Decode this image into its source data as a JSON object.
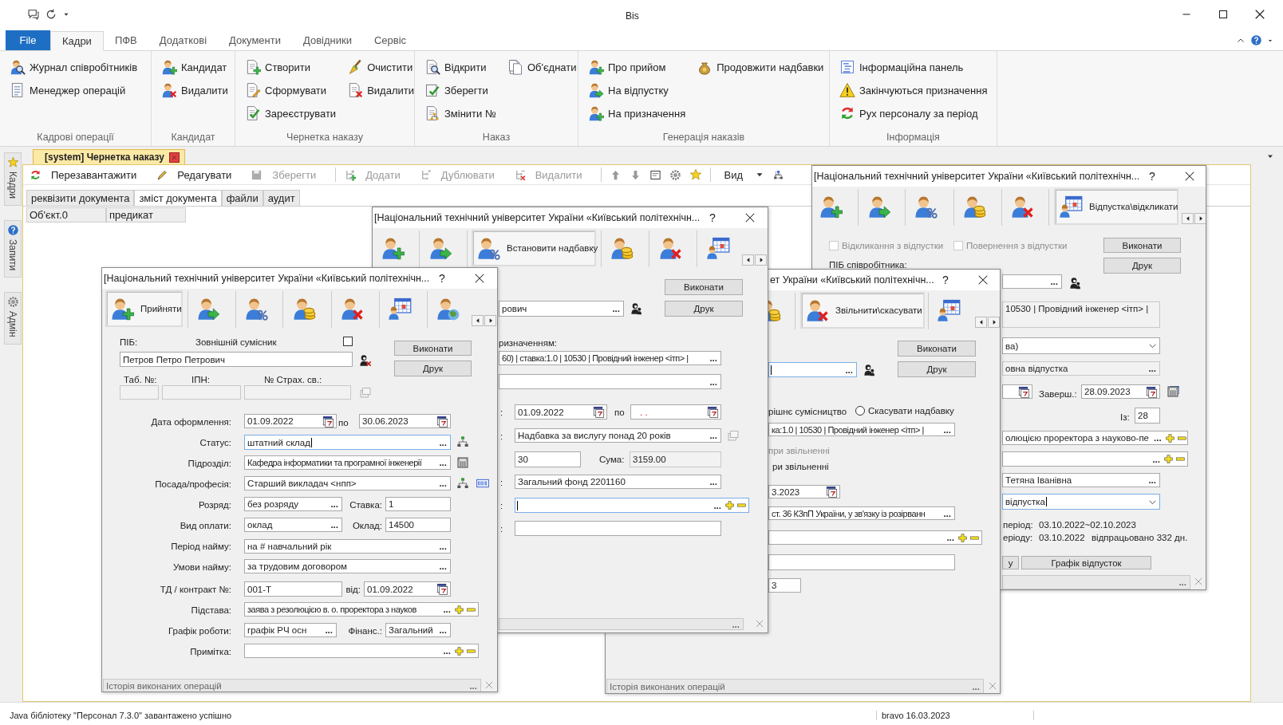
{
  "window": {
    "title": "Bis"
  },
  "ribbon": {
    "file_button": "File",
    "tabs": [
      {
        "label": "Кадри",
        "selected": true
      },
      {
        "label": "ПФВ",
        "selected": false
      },
      {
        "label": "Додаткові",
        "selected": false
      },
      {
        "label": "Документи",
        "selected": false
      },
      {
        "label": "Довідники",
        "selected": false
      },
      {
        "label": "Сервіс",
        "selected": false
      }
    ],
    "groups": [
      {
        "label": "Кадрові операції",
        "columns": [
          [
            {
              "label": "Журнал співробітників"
            },
            {
              "label": "Менеджер операцій"
            }
          ]
        ]
      },
      {
        "label": "Кандидат",
        "columns": [
          [
            {
              "label": "Кандидат"
            },
            {
              "label": "Видалити"
            }
          ]
        ]
      },
      {
        "label": "Чернетка наказу",
        "columns": [
          [
            {
              "label": "Створити"
            },
            {
              "label": "Сформувати"
            },
            {
              "label": "Зареєструвати"
            }
          ],
          [
            {
              "label": "Очистити"
            },
            {
              "label": "Видалити"
            }
          ]
        ]
      },
      {
        "label": "Наказ",
        "columns": [
          [
            {
              "label": "Відкрити"
            },
            {
              "label": "Зберегти"
            },
            {
              "label": "Змінити №"
            }
          ],
          [
            {
              "label": "Об'єднати"
            }
          ]
        ]
      },
      {
        "label": "Генерація наказів",
        "columns": [
          [
            {
              "label": "Про прийом"
            },
            {
              "label": "На відпустку"
            },
            {
              "label": "На призначення"
            }
          ],
          [
            {
              "label": "Продовжити надбавки"
            }
          ]
        ]
      },
      {
        "label": "Інформація",
        "columns": [
          [
            {
              "label": "Інформаційна панель"
            },
            {
              "label": "Закінчуються призначення"
            },
            {
              "label": "Рух персоналу за період"
            }
          ]
        ]
      }
    ]
  },
  "sidebar": [
    {
      "label": "Кадри"
    },
    {
      "label": "Запити"
    },
    {
      "label": "Адмін"
    }
  ],
  "document_tab": {
    "label": "[system] Чернетка наказу"
  },
  "toolbar": {
    "items": [
      {
        "label": "Перезавантажити",
        "disabled": false
      },
      {
        "label": "Редагувати",
        "disabled": false
      },
      {
        "label": "Зберегти",
        "disabled": true
      },
      {
        "label": "Додати",
        "disabled": true
      },
      {
        "label": "Дублювати",
        "disabled": true
      },
      {
        "label": "Видалити",
        "disabled": true
      }
    ],
    "view": "Вид"
  },
  "document_tabs": [
    {
      "label": "реквізити документа",
      "selected": false
    },
    {
      "label": "зміст документа",
      "selected": true
    },
    {
      "label": "файли",
      "selected": false
    },
    {
      "label": "аудит",
      "selected": false
    }
  ],
  "grid_columns": [
    "Об'єкт.0",
    "предикат"
  ],
  "dialogs": [
    {
      "title": "[Національний технічний університет України «Київський політехнічн...",
      "help": "?",
      "tools": [
        {
          "selected": false
        },
        {
          "selected": false
        },
        {
          "selected": false
        },
        {
          "selected": false
        },
        {
          "selected": false
        },
        {
          "label": "Відпустка\\відкликати",
          "selected": true
        }
      ],
      "controls": [
        {
          "kind": "checkbox",
          "label": "Відкликання з відпустки",
          "checked": false,
          "disabled": true
        },
        {
          "kind": "checkbox",
          "label": "Повернення з відпустки",
          "checked": false,
          "disabled": true
        },
        {
          "kind": "button",
          "label": "Виконати"
        },
        {
          "kind": "button",
          "label": "Друк"
        },
        {
          "kind": "label",
          "text": "ПІБ співробітника:"
        },
        {
          "kind": "field",
          "ellipsis": "...",
          "focused": false,
          "readonly": false
        },
        {
          "kind": "field",
          "value": "10530 | Провідний інженер <ітп> |",
          "focused": false,
          "readonly": true
        },
        {
          "kind": "dropdown",
          "value": "ва)",
          "focused": false,
          "readonly": false
        },
        {
          "kind": "field",
          "value": "овна відпустка",
          "ellipsis": "...",
          "focused": false,
          "readonly": true
        },
        {
          "kind": "date",
          "focused": false,
          "readonly": false
        },
        {
          "kind": "label",
          "text": "Заверш.:"
        },
        {
          "kind": "date",
          "value": "28.09.2023",
          "focused": false,
          "readonly": false
        },
        {
          "kind": "label",
          "text": "Із:"
        },
        {
          "kind": "field",
          "value": "28",
          "focused": false,
          "readonly": false
        },
        {
          "kind": "field",
          "value": "олюцією проректора з науково-пе",
          "ellipsis": "...",
          "plus_minus": true,
          "focused": false,
          "readonly": false
        },
        {
          "kind": "field",
          "ellipsis": "...",
          "plus_minus": true,
          "focused": false,
          "readonly": false
        },
        {
          "kind": "field",
          "value": "Тетяна Іванівна",
          "ellipsis": "...",
          "focused": false,
          "readonly": false
        },
        {
          "kind": "dropdown",
          "value": "відпустка",
          "focused": true,
          "readonly": false
        },
        {
          "kind": "label",
          "text": "період:"
        },
        {
          "kind": "label",
          "text": "03.10.2022~02.10.2023"
        },
        {
          "kind": "label",
          "text": "еріоду:"
        },
        {
          "kind": "label",
          "text": "03.10.2022"
        },
        {
          "kind": "label",
          "text": "відпрацьовано 332 дн."
        },
        {
          "kind": "button",
          "label": "у"
        },
        {
          "kind": "button",
          "label": "Графік відпусток"
        },
        {
          "kind": "status",
          "ellipsis": "...",
          "focused": false,
          "readonly": true
        }
      ]
    },
    {
      "title": "ет України «Київський політехнічн...",
      "help": "?",
      "tools": [
        {
          "selected": false
        },
        {
          "label": "Звільнити\\скасувати",
          "selected": true
        },
        {
          "selected": false
        }
      ],
      "controls": [
        {
          "kind": "field",
          "ellipsis": "...",
          "focused": true,
          "readonly": false
        },
        {
          "kind": "button",
          "label": "Виконати"
        },
        {
          "kind": "button",
          "label": "Друк"
        },
        {
          "kind": "label",
          "text": "рішнє сумісництво"
        },
        {
          "kind": "radio",
          "label": "Скасувати надбавку",
          "selected": false
        },
        {
          "kind": "field",
          "value": "ка:1.0 | 10530 | Провідний інженер <ітп> |",
          "ellipsis": "...",
          "focused": false,
          "readonly": false
        },
        {
          "kind": "greyed",
          "text": "при звільненні"
        },
        {
          "kind": "label",
          "text": "ри звільненні"
        },
        {
          "kind": "date",
          "value": "3.2023",
          "focused": false,
          "readonly": false
        },
        {
          "kind": "field",
          "value": "ст. 36 КЗпП України, у зв'язку із розірванн",
          "ellipsis": "...",
          "focused": false,
          "readonly": false
        },
        {
          "kind": "field",
          "ellipsis": "...",
          "plus_minus": true,
          "focused": false,
          "readonly": false
        },
        {
          "kind": "field",
          "focused": false,
          "readonly": false
        },
        {
          "kind": "field",
          "value": "3",
          "focused": false,
          "readonly": false
        },
        {
          "kind": "status",
          "value": "Історія виконаних операцій",
          "ellipsis": "...",
          "focused": false,
          "readonly": true
        }
      ]
    },
    {
      "title": "[Національний технічний університет України «Київський політехнічн...",
      "help": "?",
      "tools": [
        {
          "selected": false
        },
        {
          "selected": false
        },
        {
          "label": "Встановити надбавку",
          "selected": true
        },
        {
          "selected": false
        },
        {
          "selected": false
        },
        {
          "selected": false
        }
      ],
      "controls": [
        {
          "kind": "field",
          "value": "рович",
          "ellipsis": "...",
          "focused": false,
          "readonly": false
        },
        {
          "kind": "button",
          "label": "Виконати"
        },
        {
          "kind": "button",
          "label": "Друк"
        },
        {
          "kind": "label",
          "text": "ризначенням:"
        },
        {
          "kind": "field",
          "value": "60) | ставка:1.0 | 10530 | Провідний інженер <ітп> |",
          "ellipsis": "...",
          "focused": false,
          "readonly": false
        },
        {
          "kind": "field",
          "ellipsis": "...",
          "focused": false,
          "readonly": false
        },
        {
          "kind": "label",
          "text": ":"
        },
        {
          "kind": "date",
          "value": "01.09.2022",
          "focused": false,
          "readonly": false
        },
        {
          "kind": "label",
          "text": "по"
        },
        {
          "kind": "date",
          "mask": ". .",
          "focused": false,
          "readonly": false
        },
        {
          "kind": "label",
          "text": ":"
        },
        {
          "kind": "field",
          "value": "Надбавка за вислугу понад 20 років",
          "ellipsis": "...",
          "focused": false,
          "readonly": false
        },
        {
          "kind": "field",
          "value": "30",
          "focused": false,
          "readonly": false
        },
        {
          "kind": "label",
          "text": "Сума:"
        },
        {
          "kind": "field",
          "value": "3159.00",
          "focused": false,
          "readonly": true
        },
        {
          "kind": "label",
          "text": ":"
        },
        {
          "kind": "field",
          "value": "Загальний фонд 2201160",
          "ellipsis": "...",
          "focused": false,
          "readonly": false
        },
        {
          "kind": "label",
          "text": ":"
        },
        {
          "kind": "field",
          "ellipsis": "...",
          "plus_minus": true,
          "focused": true,
          "readonly": false
        },
        {
          "kind": "label",
          "text": ":"
        },
        {
          "kind": "field",
          "focused": false,
          "readonly": false
        },
        {
          "kind": "status",
          "ellipsis": "...",
          "focused": false,
          "readonly": true
        }
      ]
    },
    {
      "title": "[Національний технічний університет України «Київський політехнічн...",
      "help": "?",
      "tools": [
        {
          "label": "Прийняти",
          "selected": true
        },
        {
          "selected": false
        },
        {
          "selected": false
        },
        {
          "selected": false
        },
        {
          "selected": false
        },
        {
          "selected": false
        },
        {
          "selected": false
        }
      ],
      "controls": [
        {
          "kind": "label",
          "text": "ПІБ:"
        },
        {
          "kind": "label",
          "text": "Зовнішній сумісник"
        },
        {
          "kind": "checkbox",
          "checked": false,
          "disabled": false
        },
        {
          "kind": "field",
          "value": "Петров Петро Петрович",
          "focused": false,
          "readonly": false
        },
        {
          "kind": "button",
          "label": "Виконати"
        },
        {
          "kind": "button",
          "label": "Друк"
        },
        {
          "kind": "label",
          "text": "Таб. №:"
        },
        {
          "kind": "label",
          "text": "ІПН:"
        },
        {
          "kind": "label",
          "text": "№ Страх. св.:"
        },
        {
          "kind": "field",
          "focused": false,
          "readonly": true
        },
        {
          "kind": "field",
          "focused": false,
          "readonly": true
        },
        {
          "kind": "field",
          "focused": false,
          "readonly": true
        },
        {
          "kind": "label",
          "text": "Дата оформлення:"
        },
        {
          "kind": "date",
          "value": "01.09.2022",
          "focused": false,
          "readonly": false
        },
        {
          "kind": "label",
          "text": "по"
        },
        {
          "kind": "date",
          "value": "30.06.2023",
          "focused": false,
          "readonly": false
        },
        {
          "kind": "label",
          "text": "Статус:"
        },
        {
          "kind": "field",
          "value": "штатний склад",
          "ellipsis": "...",
          "focused": true,
          "readonly": false
        },
        {
          "kind": "label",
          "text": "Підрозділ:"
        },
        {
          "kind": "field",
          "value": "Кафедра інформатики та програмної інженерії",
          "ellipsis": "...",
          "focused": false,
          "readonly": false
        },
        {
          "kind": "label",
          "text": "Посада/професія:"
        },
        {
          "kind": "field",
          "value": "Старший викладач <нпп>",
          "ellipsis": "...",
          "focused": false,
          "readonly": false
        },
        {
          "kind": "label",
          "text": "Розряд:"
        },
        {
          "kind": "field",
          "value": "без розряду",
          "ellipsis": "...",
          "focused": false,
          "readonly": false
        },
        {
          "kind": "label",
          "text": "Ставка:"
        },
        {
          "kind": "field",
          "value": "1",
          "focused": false,
          "readonly": false
        },
        {
          "kind": "label",
          "text": "Вид оплати:"
        },
        {
          "kind": "field",
          "value": "оклад",
          "ellipsis": "...",
          "focused": false,
          "readonly": false
        },
        {
          "kind": "label",
          "text": "Оклад:"
        },
        {
          "kind": "field",
          "value": "14500",
          "focused": false,
          "readonly": false
        },
        {
          "kind": "label",
          "text": "Період найму:"
        },
        {
          "kind": "field",
          "value": "на # навчальний рік",
          "ellipsis": "...",
          "focused": false,
          "readonly": false
        },
        {
          "kind": "label",
          "text": "Умови найму:"
        },
        {
          "kind": "field",
          "value": "за трудовим договором",
          "ellipsis": "...",
          "focused": false,
          "readonly": false
        },
        {
          "kind": "label",
          "text": "ТД / контракт №:"
        },
        {
          "kind": "field",
          "value": "001-Т",
          "focused": false,
          "readonly": false
        },
        {
          "kind": "label",
          "text": "від:"
        },
        {
          "kind": "date",
          "value": "01.09.2022",
          "focused": false,
          "readonly": false
        },
        {
          "kind": "label",
          "text": "Підстава:"
        },
        {
          "kind": "field",
          "value": "заява з резолюцією в. о. проректора з науков",
          "ellipsis": "...",
          "plus_minus": true,
          "focused": false,
          "readonly": false
        },
        {
          "kind": "label",
          "text": "Графік роботи:"
        },
        {
          "kind": "field",
          "value": "графік РЧ осн",
          "ellipsis": "...",
          "focused": false,
          "readonly": false
        },
        {
          "kind": "label",
          "text": "Фінанс.:"
        },
        {
          "kind": "field",
          "value": "Загальний",
          "ellipsis": "...",
          "focused": false,
          "readonly": false
        },
        {
          "kind": "label",
          "text": "Примітка:"
        },
        {
          "kind": "field",
          "ellipsis": "...",
          "plus_minus": true,
          "focused": false,
          "readonly": false
        },
        {
          "kind": "status",
          "value": "Історія виконаних операцій",
          "ellipsis": "...",
          "focused": false,
          "readonly": true
        }
      ]
    }
  ],
  "status_bar": {
    "message": "Java бібліотеку \"Персонал 7.3.0\" завантажено успішно",
    "user": "bravo 16.03.2023"
  }
}
